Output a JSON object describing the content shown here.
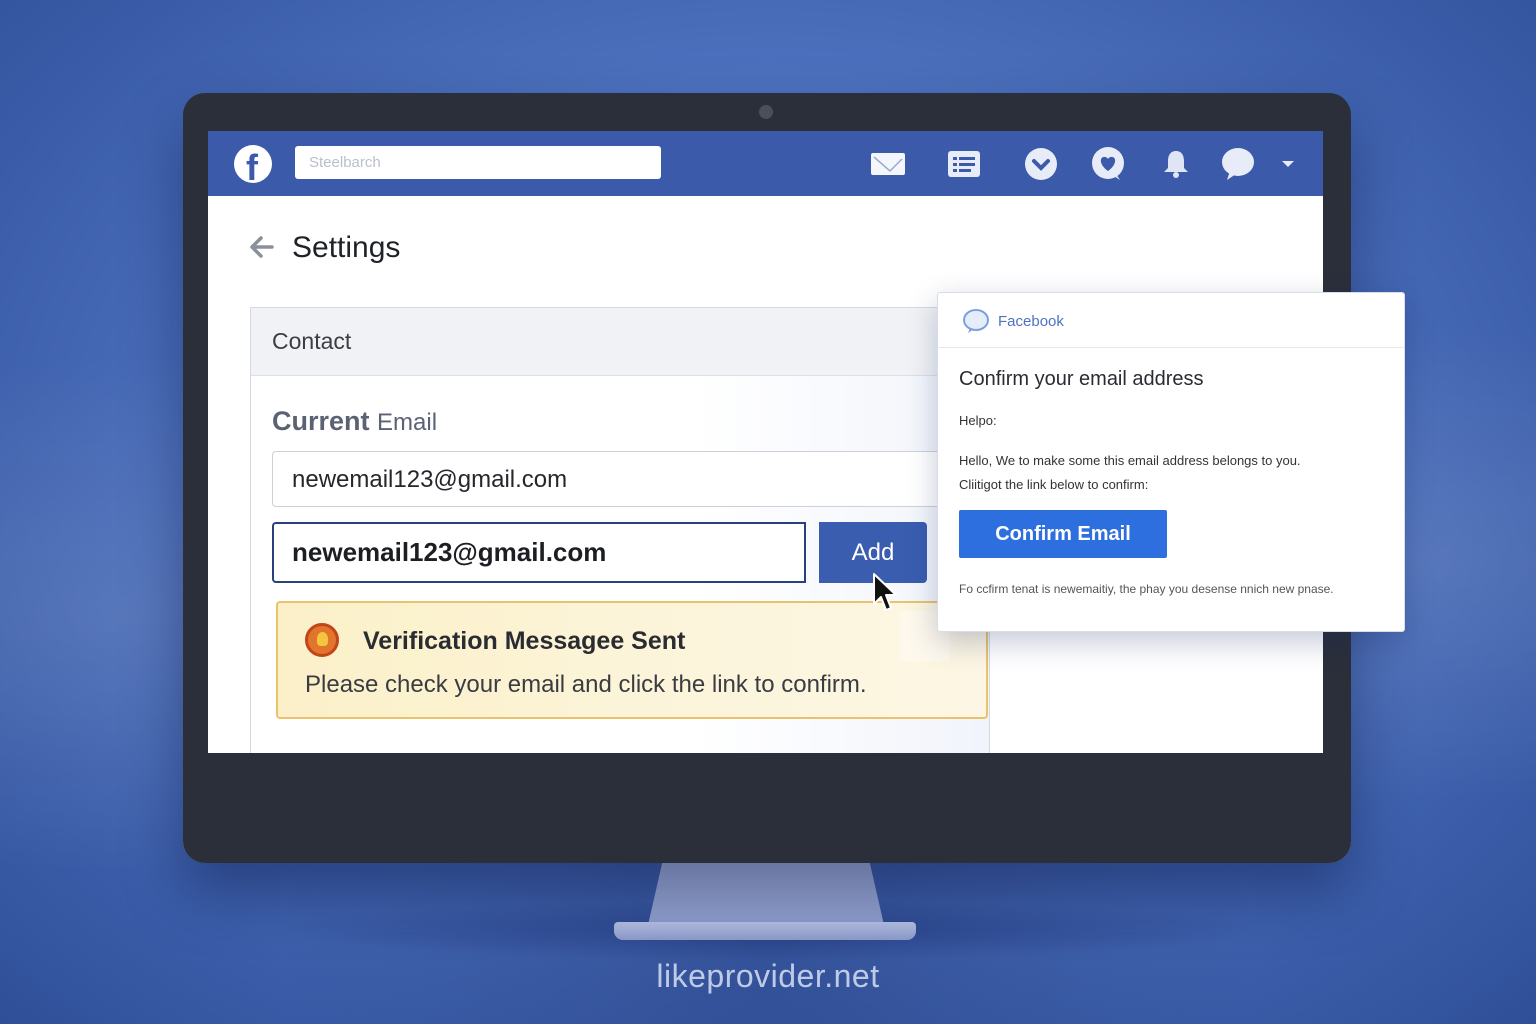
{
  "topbar": {
    "search_placeholder": "Steelbarch",
    "icons": [
      "inbox-icon",
      "news-feed-icon",
      "check-circle-icon",
      "chat-heart-icon",
      "bell-icon",
      "speech-bubble-icon",
      "caret-down-icon"
    ]
  },
  "page": {
    "title": "Settings"
  },
  "contact": {
    "header": "Contact",
    "current_label_bold": "Current",
    "current_label_light": "Email",
    "current_email": "newemail123@gmail.com",
    "new_email_value": "newemail123@gmail.com",
    "add_label": "Add"
  },
  "alert": {
    "title": "Verification Messagee Sent",
    "text": "Please check your email and click the link to confirm."
  },
  "email_popup": {
    "source": "Facebook",
    "title": "Confirm your email address",
    "greeting": "Helpo:",
    "body_line1": "Hello, We to make some this email address belongs to you.",
    "body_line2": "Cliitigot the link below to confirm:",
    "confirm_label": "Confirm Email",
    "footer": "Fo ccfirm tenat is newemaitiy, the phay you desense nnich new pnase."
  },
  "watermark": "likeprovider.net",
  "colors": {
    "brand_blue": "#3b5aa9",
    "confirm_blue": "#2e6fe0",
    "alert_bg": "#fbf0c8",
    "alert_border": "#e9c26b"
  }
}
